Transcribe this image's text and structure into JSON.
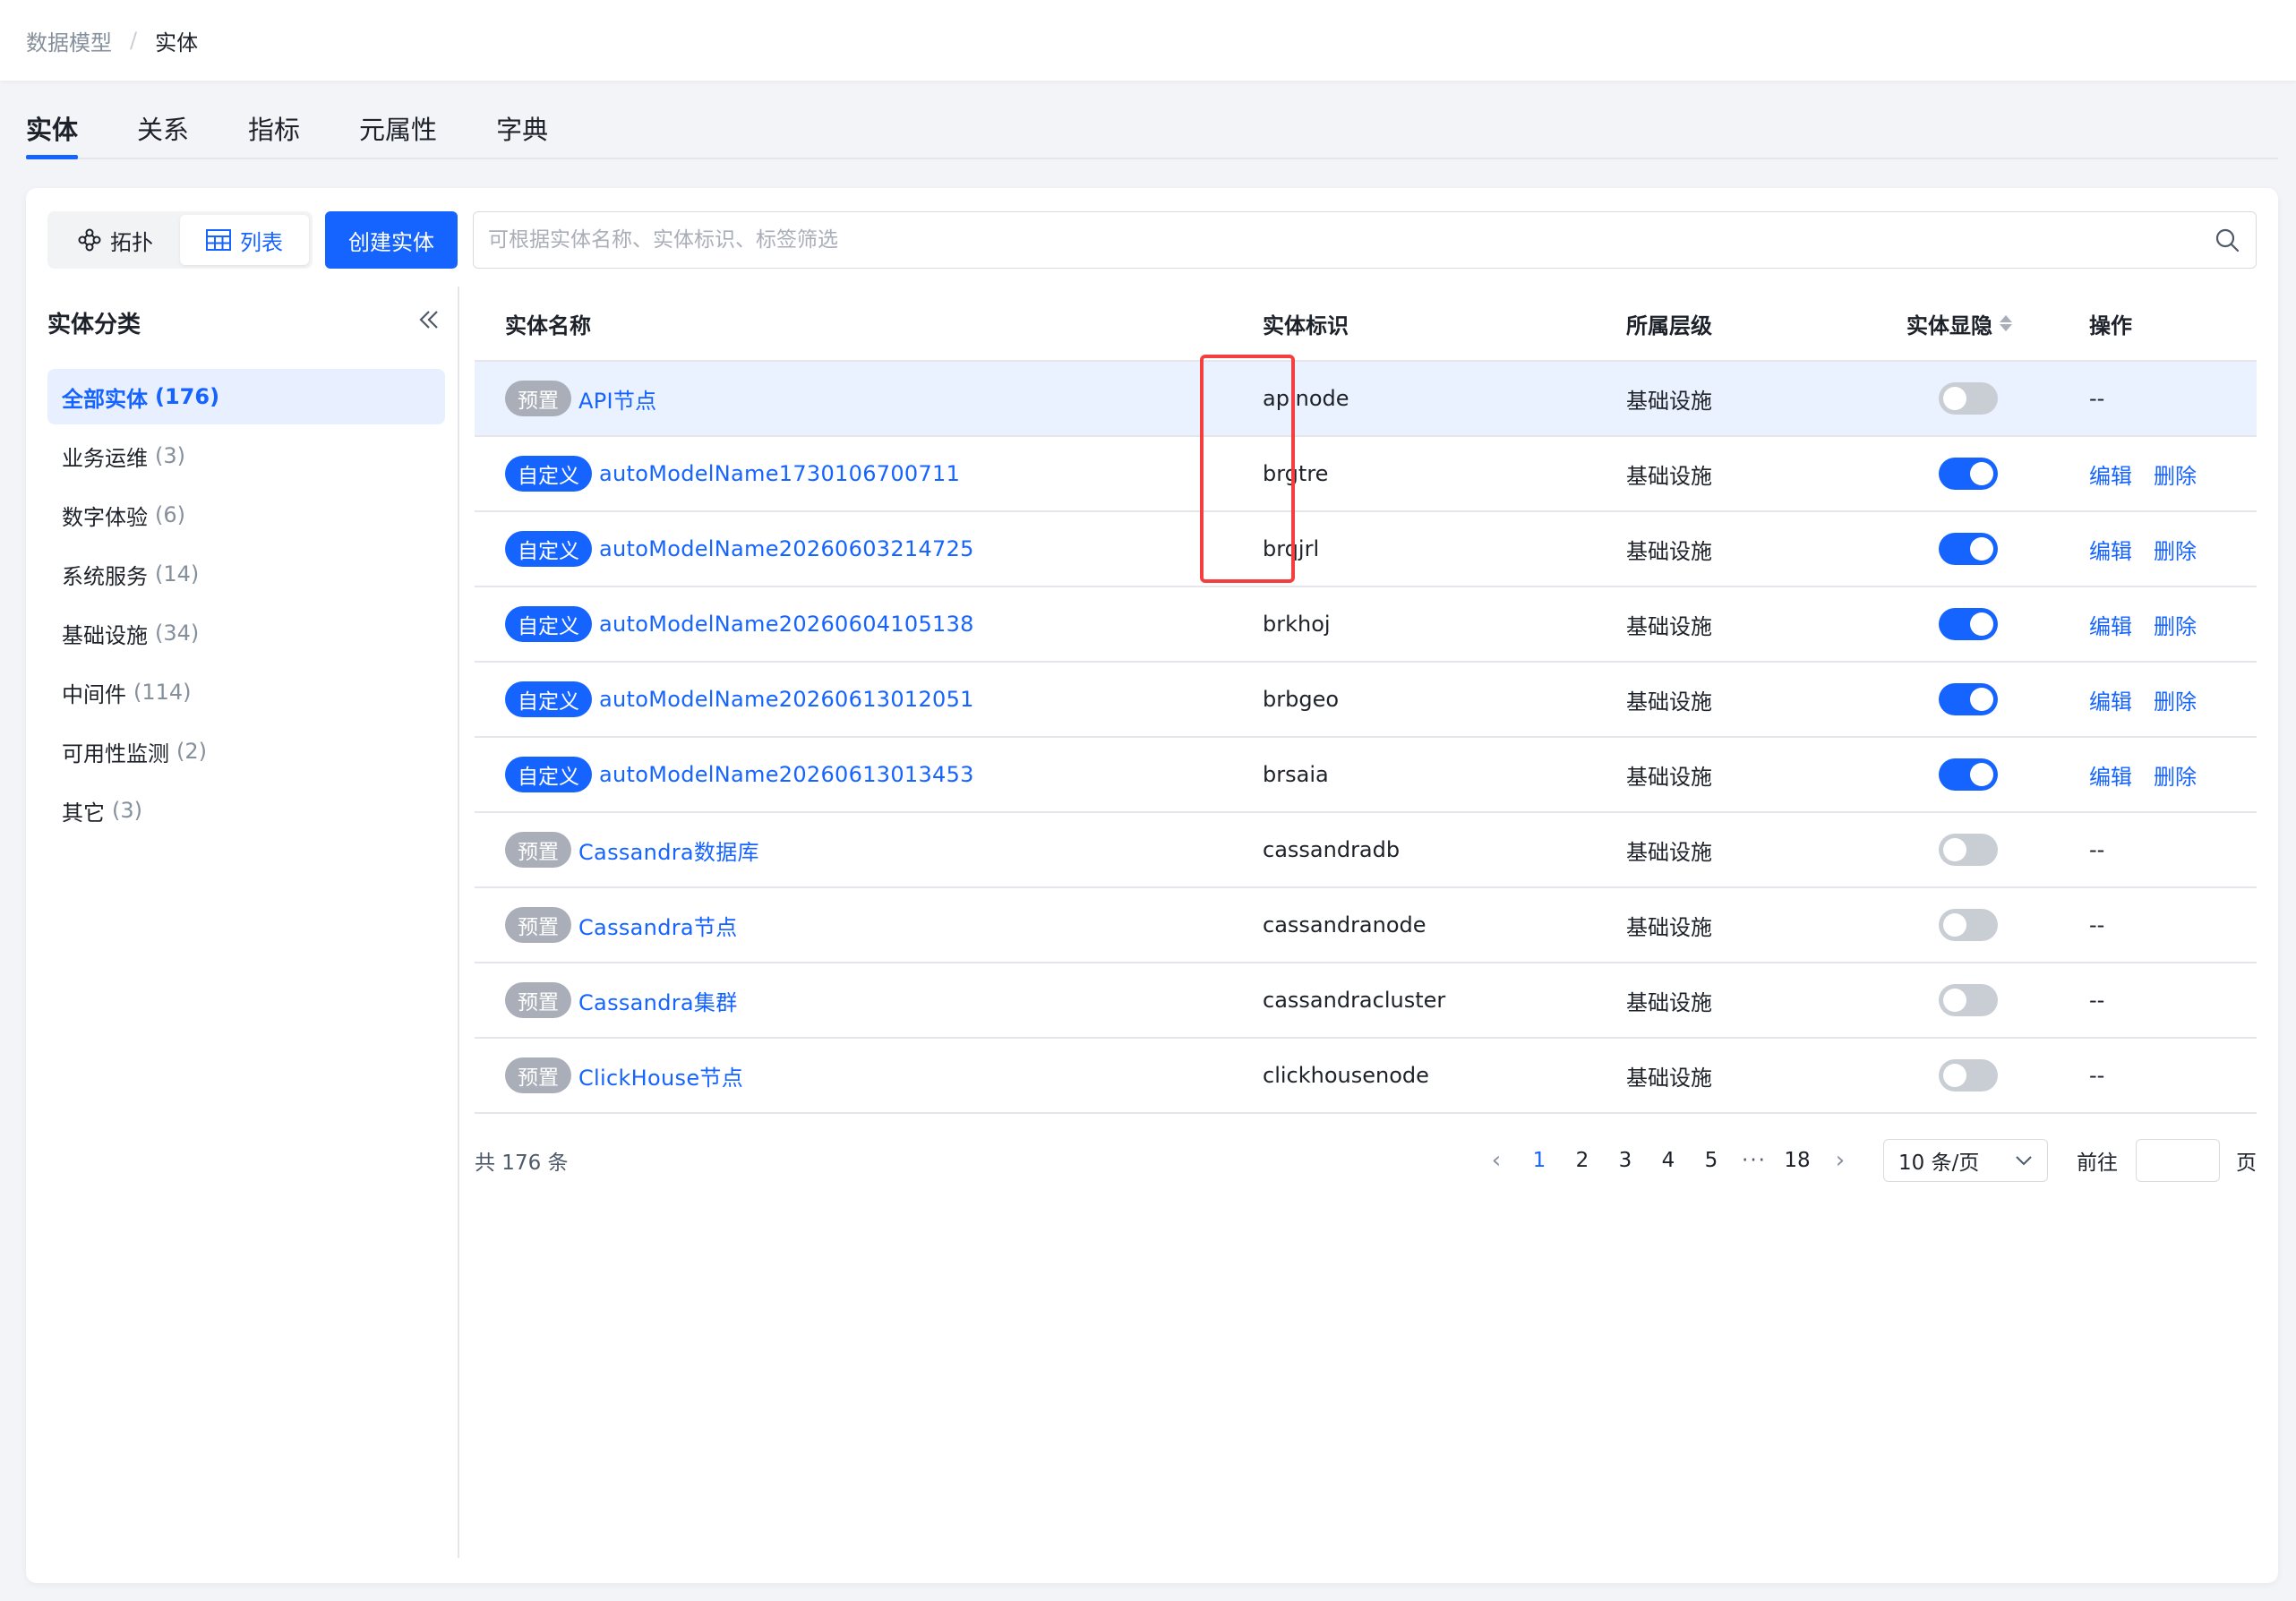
{
  "breadcrumb": {
    "parent": "数据模型",
    "sep": "/",
    "current": "实体"
  },
  "tabs": [
    {
      "label": "实体",
      "active": true
    },
    {
      "label": "关系"
    },
    {
      "label": "指标"
    },
    {
      "label": "元属性"
    },
    {
      "label": "字典"
    }
  ],
  "toolbar": {
    "view_topology": "拓扑",
    "view_list": "列表",
    "create_label": "创建实体",
    "search_placeholder": "可根据实体名称、实体标识、标签筛选"
  },
  "sidebar": {
    "title": "实体分类",
    "items": [
      {
        "label": "全部实体",
        "count": "(176)",
        "active": true
      },
      {
        "label": "业务运维",
        "count": "(3)"
      },
      {
        "label": "数字体验",
        "count": "(6)"
      },
      {
        "label": "系统服务",
        "count": "(14)"
      },
      {
        "label": "基础设施",
        "count": "(34)"
      },
      {
        "label": "中间件",
        "count": "(114)"
      },
      {
        "label": "可用性监测",
        "count": "(2)"
      },
      {
        "label": "其它",
        "count": "(3)"
      }
    ]
  },
  "table": {
    "headers": {
      "name": "实体名称",
      "id": "实体标识",
      "layer": "所属层级",
      "visible": "实体显隐",
      "ops": "操作"
    },
    "rows": [
      {
        "tag": "预置",
        "tag_type": "preset",
        "name": "API节点",
        "id": "apinode",
        "layer": "基础设施",
        "visible": false,
        "ops": "--"
      },
      {
        "tag": "自定义",
        "tag_type": "custom",
        "name": "autoModelName1730106700711",
        "id": "brgtre",
        "layer": "基础设施",
        "visible": true,
        "edit": "编辑",
        "delete": "删除"
      },
      {
        "tag": "自定义",
        "tag_type": "custom",
        "name": "autoModelName20260603214725",
        "id": "brqjrl",
        "layer": "基础设施",
        "visible": true,
        "edit": "编辑",
        "delete": "删除"
      },
      {
        "tag": "自定义",
        "tag_type": "custom",
        "name": "autoModelName20260604105138",
        "id": "brkhoj",
        "layer": "基础设施",
        "visible": true,
        "edit": "编辑",
        "delete": "删除"
      },
      {
        "tag": "自定义",
        "tag_type": "custom",
        "name": "autoModelName20260613012051",
        "id": "brbgeo",
        "layer": "基础设施",
        "visible": true,
        "edit": "编辑",
        "delete": "删除"
      },
      {
        "tag": "自定义",
        "tag_type": "custom",
        "name": "autoModelName20260613013453",
        "id": "brsaia",
        "layer": "基础设施",
        "visible": true,
        "edit": "编辑",
        "delete": "删除"
      },
      {
        "tag": "预置",
        "tag_type": "preset",
        "name": "Cassandra数据库",
        "id": "cassandradb",
        "layer": "基础设施",
        "visible": false,
        "ops": "--"
      },
      {
        "tag": "预置",
        "tag_type": "preset",
        "name": "Cassandra节点",
        "id": "cassandranode",
        "layer": "基础设施",
        "visible": false,
        "ops": "--"
      },
      {
        "tag": "预置",
        "tag_type": "preset",
        "name": "Cassandra集群",
        "id": "cassandracluster",
        "layer": "基础设施",
        "visible": false,
        "ops": "--"
      },
      {
        "tag": "预置",
        "tag_type": "preset",
        "name": "ClickHouse节点",
        "id": "clickhousenode",
        "layer": "基础设施",
        "visible": false,
        "ops": "--"
      }
    ]
  },
  "pagination": {
    "total": "共 176 条",
    "pages": [
      "1",
      "2",
      "3",
      "4",
      "5"
    ],
    "current": "1",
    "ellipsis": "···",
    "last": "18",
    "page_size": "10 条/页",
    "goto_label": "前往",
    "goto_suffix": "页"
  },
  "colors": {
    "primary": "#1664ff",
    "highlight": "#f53f3f",
    "preset_tag": "#a9aeb8"
  }
}
